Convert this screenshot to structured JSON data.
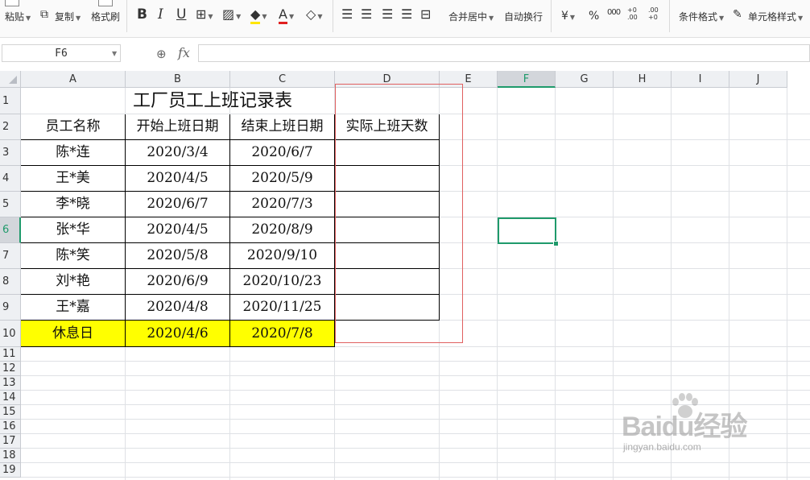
{
  "toolbar": {
    "paste": "粘贴",
    "copy": "复制",
    "format_painter": "格式刷",
    "bold": "B",
    "italic": "I",
    "underline": "U",
    "merge_center": "合并居中",
    "auto_wrap": "自动换行",
    "currency": "¥",
    "percent": "%",
    "thousands": "000",
    "inc_decimal": "+0 .00",
    "dec_decimal": ".00 +0",
    "conditional_format": "条件格式",
    "cell_style": "单元格样式",
    "font_color_accent": "#e02020",
    "highlight_accent": "#ffe600"
  },
  "formula_bar": {
    "name_box": "F6",
    "fx": "fx",
    "value": ""
  },
  "columns": [
    "A",
    "B",
    "C",
    "D",
    "E",
    "F",
    "G",
    "H",
    "I",
    "J"
  ],
  "selected_column": "F",
  "rows": [
    "1",
    "2",
    "3",
    "4",
    "5",
    "6",
    "7",
    "8",
    "9",
    "10",
    "11",
    "12",
    "13",
    "14",
    "15",
    "16",
    "17",
    "18",
    "19"
  ],
  "selected_row": "6",
  "sheet": {
    "title": "工厂员工上班记录表",
    "headers": [
      "员工名称",
      "开始上班日期",
      "结束上班日期",
      "实际上班天数"
    ],
    "records": [
      {
        "name": "陈*连",
        "start": "2020/3/4",
        "end": "2020/6/7"
      },
      {
        "name": "王*美",
        "start": "2020/4/5",
        "end": "2020/5/9"
      },
      {
        "name": "李*晓",
        "start": "2020/6/7",
        "end": "2020/7/3"
      },
      {
        "name": "张*华",
        "start": "2020/4/5",
        "end": "2020/8/9"
      },
      {
        "name": "陈*笑",
        "start": "2020/5/8",
        "end": "2020/9/10"
      },
      {
        "name": "刘*艳",
        "start": "2020/6/9",
        "end": "2020/10/23"
      },
      {
        "name": "王*嘉",
        "start": "2020/4/8",
        "end": "2020/11/25"
      }
    ],
    "holiday": {
      "name": "休息日",
      "start": "2020/4/6",
      "end": "2020/7/8"
    },
    "holiday_color": "#ffff00",
    "selection_color": "#1f9a6b",
    "annotation_box_color": "#e06060"
  },
  "watermark": {
    "logo": "Baidu经验",
    "url": "jingyan.baidu.com"
  }
}
